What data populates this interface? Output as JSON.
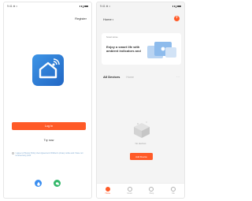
{
  "login_screen": {
    "status": {
      "time": "9:41 ⊕ ◐"
    },
    "register_label": "Register",
    "login_label": "Log In",
    "try_label": "Try now",
    "agreement_text": "I agree to Privacy Policy User Agreement Children's privacy notice and I have not received any proof",
    "social": [
      {
        "name": "weibo",
        "icon": "drop-icon"
      },
      {
        "name": "wechat",
        "icon": "chat-icon"
      }
    ],
    "colors": {
      "accent": "#ff5a27",
      "logo": "#2f7fd6"
    }
  },
  "home_screen": {
    "status": {
      "time": "9:41 ⊕ ◐"
    },
    "title": "Home",
    "banner": {
      "tag": "Smart Home",
      "headline": "Enjoy a smart life with ambient indicators and"
    },
    "tabs": [
      "All Devices",
      "Home"
    ],
    "more": "···",
    "empty_label": "No devices",
    "add_device_label": "Add Device",
    "nav": [
      {
        "label": "Home",
        "active": true
      },
      {
        "label": "Smart",
        "active": false
      },
      {
        "label": "Shop",
        "active": false
      },
      {
        "label": "Me",
        "active": false
      }
    ]
  }
}
